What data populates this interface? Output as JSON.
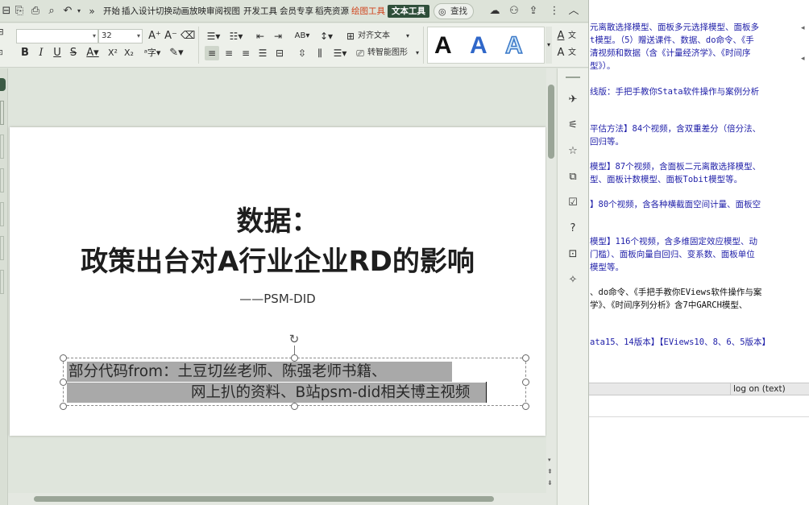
{
  "tabs": [
    "开始",
    "插入",
    "设计",
    "切换",
    "动画",
    "放映",
    "审阅",
    "视图",
    "开发工具",
    "会员专享",
    "稻壳资源",
    "绘图工具",
    "文本工具"
  ],
  "search_label": "查找",
  "toolbar": {
    "font_size": "32",
    "align_text_label": "对齐文本",
    "smart_art_label": "转智能图形",
    "art_letter": "A",
    "side_label_top": "文",
    "side_label_bottom": "文"
  },
  "slide": {
    "title_line1": "数据：",
    "title_line2": "政策出台对A行业企业RD的影响",
    "subtitle": "——PSM-DID",
    "body_line1": "部分代码from：土豆切丝老师、陈强老师书籍、",
    "body_line2": "网上扒的资料、B站psm-did相关博主视频"
  },
  "right_panel": {
    "lines": [
      "元离散选择模型、面板多元选择模型、面板多",
      "t模型。（5）赠送课件、数据、do命令、《手",
      "清视频和数据（含《计量经济学》、《时间序",
      "型》）。",
      "线版：手把手教你Stata软件操作与案例分析",
      "平估方法】84个视频，含双重差分（倍分法、",
      "回归等。",
      "模型】87个视频，含面板二元离散选择模型、",
      "型、面板计数模型、面板Tobit模型等。",
      "】80个视频，含各种横截面空间计量、面板空",
      "模型】116个视频，含多维固定效应模型、动",
      "门槛）、面板向量自回归、变系数、面板单位",
      "模型等。",
      "、do命令、《手把手教你EViews软件操作与案",
      "学》、《时间序列分析》含7中GARCH模型、",
      "ata15、14版本】【EViews10、8、6、5版本】"
    ],
    "log_label": "log on (text)"
  },
  "colors": {
    "accent": "#2f4f3a",
    "drawing_tools": "#d0421b",
    "highlight": "#a9a9a9",
    "link_text": "#1e1ea8"
  }
}
